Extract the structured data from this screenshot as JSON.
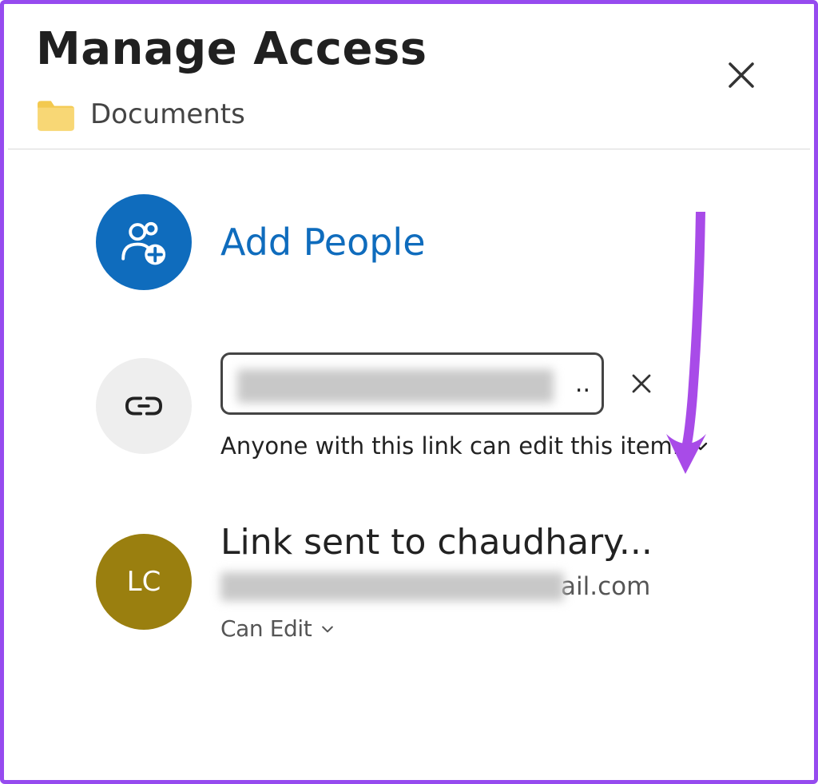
{
  "dialog": {
    "title": "Manage Access",
    "folder_name": "Documents"
  },
  "add_people": {
    "label": "Add People"
  },
  "share_link": {
    "truncated_indicator": "..",
    "description": "Anyone with this link can edit this item."
  },
  "recipient": {
    "avatar_initials": "LC",
    "title": "Link sent to chaudhary...",
    "email_visible_suffix": "ail.com",
    "permission_label": "Can Edit"
  },
  "colors": {
    "frame": "#964bef",
    "accent_blue": "#0f6cbd",
    "avatar_olive": "#9a7f0f",
    "arrow": "#a84be8"
  }
}
